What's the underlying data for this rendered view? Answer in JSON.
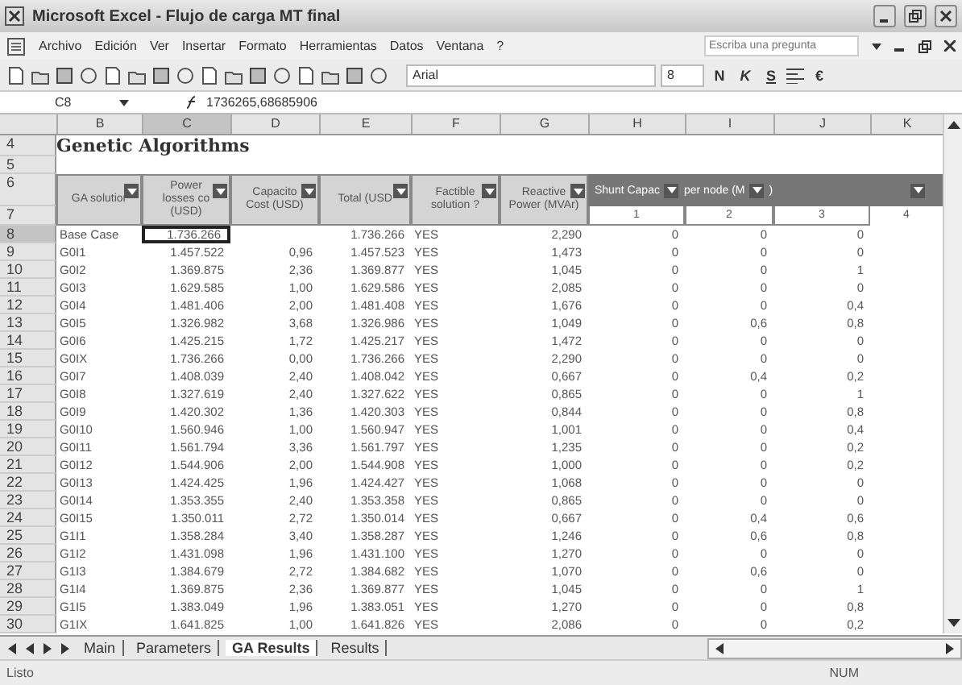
{
  "window": {
    "title": "Microsoft Excel - Flujo de carga MT final"
  },
  "menu": [
    "Archivo",
    "Edición",
    "Ver",
    "Insertar",
    "Formato",
    "Herramientas",
    "Datos",
    "Ventana",
    "?"
  ],
  "help_search": {
    "placeholder": "Escriba una pregunta"
  },
  "toolbar": {
    "font": "Arial",
    "size": "8",
    "format_buttons": [
      "N",
      "K",
      "S"
    ],
    "currency": "€"
  },
  "formula_bar": {
    "name_box": "C8",
    "formula": "1736265,68685906"
  },
  "columns": [
    {
      "letter": "B",
      "selected": false
    },
    {
      "letter": "C",
      "selected": true
    },
    {
      "letter": "D",
      "selected": false
    },
    {
      "letter": "E",
      "selected": false
    },
    {
      "letter": "F",
      "selected": false
    },
    {
      "letter": "G",
      "selected": false
    },
    {
      "letter": "H",
      "selected": false
    },
    {
      "letter": "I",
      "selected": false
    },
    {
      "letter": "J",
      "selected": false
    },
    {
      "letter": "K",
      "selected": false
    }
  ],
  "sheet_title": {
    "row": "4",
    "text": "Genetic Algorithms"
  },
  "empty_row": "5",
  "header_rows": [
    "6",
    "7"
  ],
  "headers": [
    {
      "lines": [
        "GA solutior"
      ],
      "filter": true
    },
    {
      "lines": [
        "Power",
        "losses co",
        "(USD)"
      ],
      "filter": true
    },
    {
      "lines": [
        "Capacito",
        "Cost (USD)"
      ],
      "filter": true
    },
    {
      "lines": [
        "Total (USD"
      ],
      "filter": true
    },
    {
      "lines": [
        "Factible",
        "solution ?"
      ],
      "filter": true
    },
    {
      "lines": [
        "Reactive",
        "Power (MVAr)"
      ],
      "filter": true
    }
  ],
  "group_header": [
    {
      "text": "Shunt Capac",
      "filter": true
    },
    {
      "text": "per node (M",
      "filter": true
    },
    {
      "text": ")",
      "filter": true
    }
  ],
  "node_numbers": [
    "1",
    "2",
    "3",
    "4"
  ],
  "rows": [
    {
      "n": "8",
      "selected": true,
      "cells": [
        "Base Case",
        "1.736.266",
        null,
        "1.736.266",
        "YES",
        "2,290",
        "0",
        "0",
        "0"
      ]
    },
    {
      "n": "9",
      "selected": false,
      "cells": [
        "G0I1",
        "1.457.522",
        "0,96",
        "1.457.523",
        "YES",
        "1,473",
        "0",
        "0",
        "0"
      ]
    },
    {
      "n": "10",
      "selected": false,
      "cells": [
        "G0I2",
        "1.369.875",
        "2,36",
        "1.369.877",
        "YES",
        "1,045",
        "0",
        "0",
        "1"
      ]
    },
    {
      "n": "11",
      "selected": false,
      "cells": [
        "G0I3",
        "1.629.585",
        "1,00",
        "1.629.586",
        "YES",
        "2,085",
        "0",
        "0",
        "0"
      ]
    },
    {
      "n": "12",
      "selected": false,
      "cells": [
        "G0I4",
        "1.481.406",
        "2,00",
        "1.481.408",
        "YES",
        "1,676",
        "0",
        "0",
        "0,4"
      ]
    },
    {
      "n": "13",
      "selected": false,
      "cells": [
        "G0I5",
        "1.326.982",
        "3,68",
        "1.326.986",
        "YES",
        "1,049",
        "0",
        "0,6",
        "0,8"
      ]
    },
    {
      "n": "14",
      "selected": false,
      "cells": [
        "G0I6",
        "1.425.215",
        "1,72",
        "1.425.217",
        "YES",
        "1,472",
        "0",
        "0",
        "0"
      ]
    },
    {
      "n": "15",
      "selected": false,
      "cells": [
        "G0IX",
        "1.736.266",
        "0,00",
        "1.736.266",
        "YES",
        "2,290",
        "0",
        "0",
        "0"
      ]
    },
    {
      "n": "16",
      "selected": false,
      "cells": [
        "G0I7",
        "1.408.039",
        "2,40",
        "1.408.042",
        "YES",
        "0,667",
        "0",
        "0,4",
        "0,2"
      ]
    },
    {
      "n": "17",
      "selected": false,
      "cells": [
        "G0I8",
        "1.327.619",
        "2,40",
        "1.327.622",
        "YES",
        "0,865",
        "0",
        "0",
        "1"
      ]
    },
    {
      "n": "18",
      "selected": false,
      "cells": [
        "G0I9",
        "1.420.302",
        "1,36",
        "1.420.303",
        "YES",
        "0,844",
        "0",
        "0",
        "0,8"
      ]
    },
    {
      "n": "19",
      "selected": false,
      "cells": [
        "G0I10",
        "1.560.946",
        "1,00",
        "1.560.947",
        "YES",
        "1,001",
        "0",
        "0",
        "0,4"
      ]
    },
    {
      "n": "20",
      "selected": false,
      "cells": [
        "G0I11",
        "1.561.794",
        "3,36",
        "1.561.797",
        "YES",
        "1,235",
        "0",
        "0",
        "0,2"
      ]
    },
    {
      "n": "21",
      "selected": false,
      "cells": [
        "G0I12",
        "1.544.906",
        "2,00",
        "1.544.908",
        "YES",
        "1,000",
        "0",
        "0",
        "0,2"
      ]
    },
    {
      "n": "22",
      "selected": false,
      "cells": [
        "G0I13",
        "1.424.425",
        "1,96",
        "1.424.427",
        "YES",
        "1,068",
        "0",
        "0",
        "0"
      ]
    },
    {
      "n": "23",
      "selected": false,
      "cells": [
        "G0I14",
        "1.353.355",
        "2,40",
        "1.353.358",
        "YES",
        "0,865",
        "0",
        "0",
        "0"
      ]
    },
    {
      "n": "24",
      "selected": false,
      "cells": [
        "G0I15",
        "1.350.011",
        "2,72",
        "1.350.014",
        "YES",
        "0,667",
        "0",
        "0,4",
        "0,6"
      ]
    },
    {
      "n": "25",
      "selected": false,
      "cells": [
        "G1I1",
        "1.358.284",
        "3,40",
        "1.358.287",
        "YES",
        "1,246",
        "0",
        "0,6",
        "0,8"
      ]
    },
    {
      "n": "26",
      "selected": false,
      "cells": [
        "G1I2",
        "1.431.098",
        "1,96",
        "1.431.100",
        "YES",
        "1,270",
        "0",
        "0",
        "0"
      ]
    },
    {
      "n": "27",
      "selected": false,
      "cells": [
        "G1I3",
        "1.384.679",
        "2,72",
        "1.384.682",
        "YES",
        "1,070",
        "0",
        "0,6",
        "0"
      ]
    },
    {
      "n": "28",
      "selected": false,
      "cells": [
        "G1I4",
        "1.369.875",
        "2,36",
        "1.369.877",
        "YES",
        "1,045",
        "0",
        "0",
        "1"
      ]
    },
    {
      "n": "29",
      "selected": false,
      "cells": [
        "G1I5",
        "1.383.049",
        "1,96",
        "1.383.051",
        "YES",
        "1,270",
        "0",
        "0",
        "0,8"
      ]
    },
    {
      "n": "30",
      "selected": false,
      "cells": [
        "G1IX",
        "1.641.825",
        "1,00",
        "1.641.826",
        "YES",
        "2,086",
        "0",
        "0",
        "0,2"
      ]
    }
  ],
  "sheet_tabs": [
    {
      "label": "Main",
      "selected": false
    },
    {
      "label": "Parameters",
      "selected": false
    },
    {
      "label": "GA Results",
      "selected": true
    },
    {
      "label": "Results",
      "selected": false
    }
  ],
  "status_bar": {
    "text": "Listo",
    "num": "NUM"
  }
}
